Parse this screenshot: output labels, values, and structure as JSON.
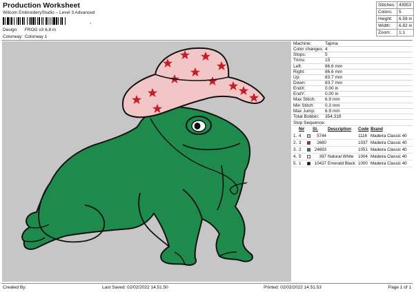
{
  "header": {
    "title": "Production Worksheet",
    "subtitle": "Wilcom EmbroideryStudio – Level 3 Advanced",
    "design_label": "Design:",
    "design_value": "FROG v3 6,8 in",
    "colorway_label": "Colorway:",
    "colorway_value": "Colorway 1",
    "barcode_mark": ","
  },
  "stats": {
    "stitches_label": "Stitches:",
    "stitches": "43953",
    "colors_label": "Colors:",
    "colors": "5",
    "height_label": "Height:",
    "height": "6.59 in",
    "width_label": "Width:",
    "width": "6.82 in",
    "zoom_label": "Zoom:",
    "zoom": "1:1"
  },
  "machine_info": [
    {
      "k": "Machine:",
      "v": "Tajima"
    },
    {
      "k": "Color changes:",
      "v": "4"
    },
    {
      "k": "Stops:",
      "v": "5"
    },
    {
      "k": "Trims:",
      "v": "15"
    },
    {
      "k": "Left:",
      "v": "86.6 mm"
    },
    {
      "k": "Right:",
      "v": "86.6 mm"
    },
    {
      "k": "Up:",
      "v": "83.7 mm"
    },
    {
      "k": "Down:",
      "v": "83.7 mm"
    },
    {
      "k": "EndX:",
      "v": "0.00 in"
    },
    {
      "k": "EndY:",
      "v": "0.00 in"
    },
    {
      "k": "Max Stitch:",
      "v": "6.9 mm"
    },
    {
      "k": "Min Stitch:",
      "v": "0.3 mm"
    },
    {
      "k": "Max Jump:",
      "v": "6.9 mm"
    },
    {
      "k": "Total Bobbin:",
      "v": "354.31ft"
    }
  ],
  "stop_sequence": {
    "title": "Stop Sequence:",
    "headers": {
      "n": "N#",
      "st": "St.",
      "desc": "Description",
      "code": "Code",
      "brand": "Brand"
    },
    "rows": [
      {
        "stop": "1.",
        "n": "4",
        "color": "#f2c6c6",
        "st": "5744",
        "desc": "",
        "code": "1116",
        "brand": "Madeira Classic 40"
      },
      {
        "stop": "2.",
        "n": "3",
        "color": "#c41e28",
        "st": "2680",
        "desc": "",
        "code": "1037",
        "brand": "Madeira Classic 40"
      },
      {
        "stop": "3.",
        "n": "2",
        "color": "#1e8a4c",
        "st": "24693",
        "desc": "",
        "code": "1051",
        "brand": "Madeira Classic 40"
      },
      {
        "stop": "4.",
        "n": "5",
        "color": "#ffffff",
        "st": "397",
        "desc": "Natural White",
        "code": "1004",
        "brand": "Madeira Classic 40"
      },
      {
        "stop": "5.",
        "n": "1",
        "color": "#111111",
        "st": "10437",
        "desc": "Emerald Black",
        "code": "1000",
        "brand": "Madeira Classic 40"
      }
    ]
  },
  "footer": {
    "created_by": "Created By:",
    "last_saved": "Last Saved: 02/02/2022 14.51.50",
    "printed": "Printed: 02/02/2022 14.51.53",
    "page": "Page 1 of 1"
  },
  "colors": {
    "frog_green": "#1e8a4c",
    "hat_pink": "#f2c6c6",
    "star_red": "#c41e28",
    "outline": "#111111",
    "canvas_gray": "#c6c6c6"
  }
}
